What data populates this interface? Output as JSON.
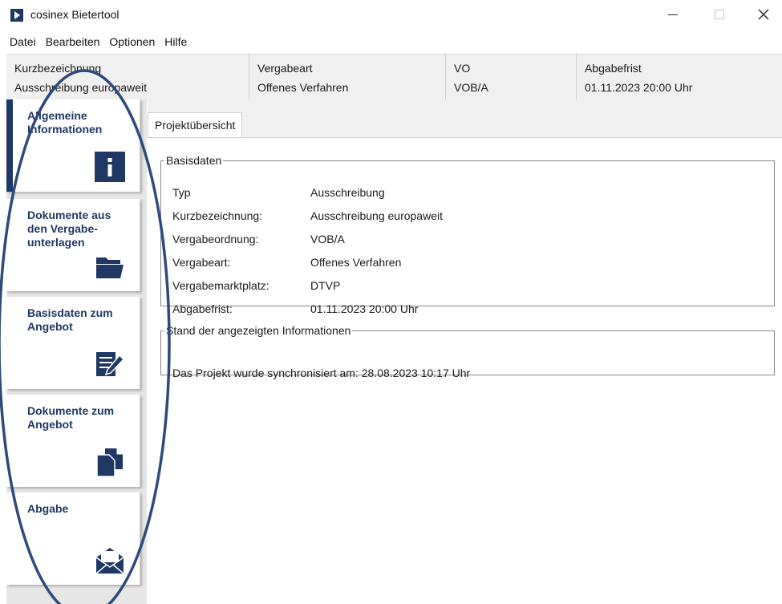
{
  "window": {
    "title": "cosinex Bietertool",
    "controls": {
      "minimize": "minimize",
      "maximize": "maximize",
      "close": "close"
    }
  },
  "menu": [
    "Datei",
    "Bearbeiten",
    "Optionen",
    "Hilfe"
  ],
  "header": {
    "kurzbezeichnung": {
      "label": "Kurzbezeichnung",
      "value": "Ausschreibung europaweit"
    },
    "vergabeart": {
      "label": "Vergabeart",
      "value": "Offenes Verfahren"
    },
    "vo": {
      "label": "VO",
      "value": "VOB/A"
    },
    "abgabefrist": {
      "label": "Abgabefrist",
      "value": "01.11.2023 20:00 Uhr"
    }
  },
  "sidebar": {
    "items": [
      {
        "label": "Allgemeine Informationen",
        "icon": "info-icon",
        "active": true
      },
      {
        "label": "Dokumente aus den Vergabe-unterlagen",
        "icon": "folder-icon",
        "active": false
      },
      {
        "label": "Basisdaten zum Angebot",
        "icon": "edit-document-icon",
        "active": false
      },
      {
        "label": "Dokumente zum Angebot",
        "icon": "documents-icon",
        "active": false
      },
      {
        "label": "Abgabe",
        "icon": "envelope-icon",
        "active": false
      }
    ]
  },
  "main": {
    "tab": "Projektübersicht",
    "basisdaten": {
      "title": "Basisdaten",
      "rows": [
        {
          "key": "Typ",
          "value": "Ausschreibung"
        },
        {
          "key": "Kurzbezeichnung:",
          "value": "Ausschreibung europaweit"
        },
        {
          "key": "Vergabeordnung:",
          "value": "VOB/A"
        },
        {
          "key": "Vergabeart:",
          "value": "Offenes Verfahren"
        },
        {
          "key": "Vergabemarktplatz:",
          "value": "DTVP"
        },
        {
          "key": "Abgabefrist:",
          "value": "01.11.2023 20:00 Uhr"
        }
      ]
    },
    "stand": {
      "title": "Stand der angezeigten Informationen",
      "text": "Das Projekt wurde synchronisiert am: 28.08.2023 10:17 Uhr"
    }
  },
  "colors": {
    "brand": "#1f3864",
    "annotation": "#2e4a7d",
    "panel_bg": "#f0f0f0",
    "sidebar_bg": "#e6e6e6"
  }
}
